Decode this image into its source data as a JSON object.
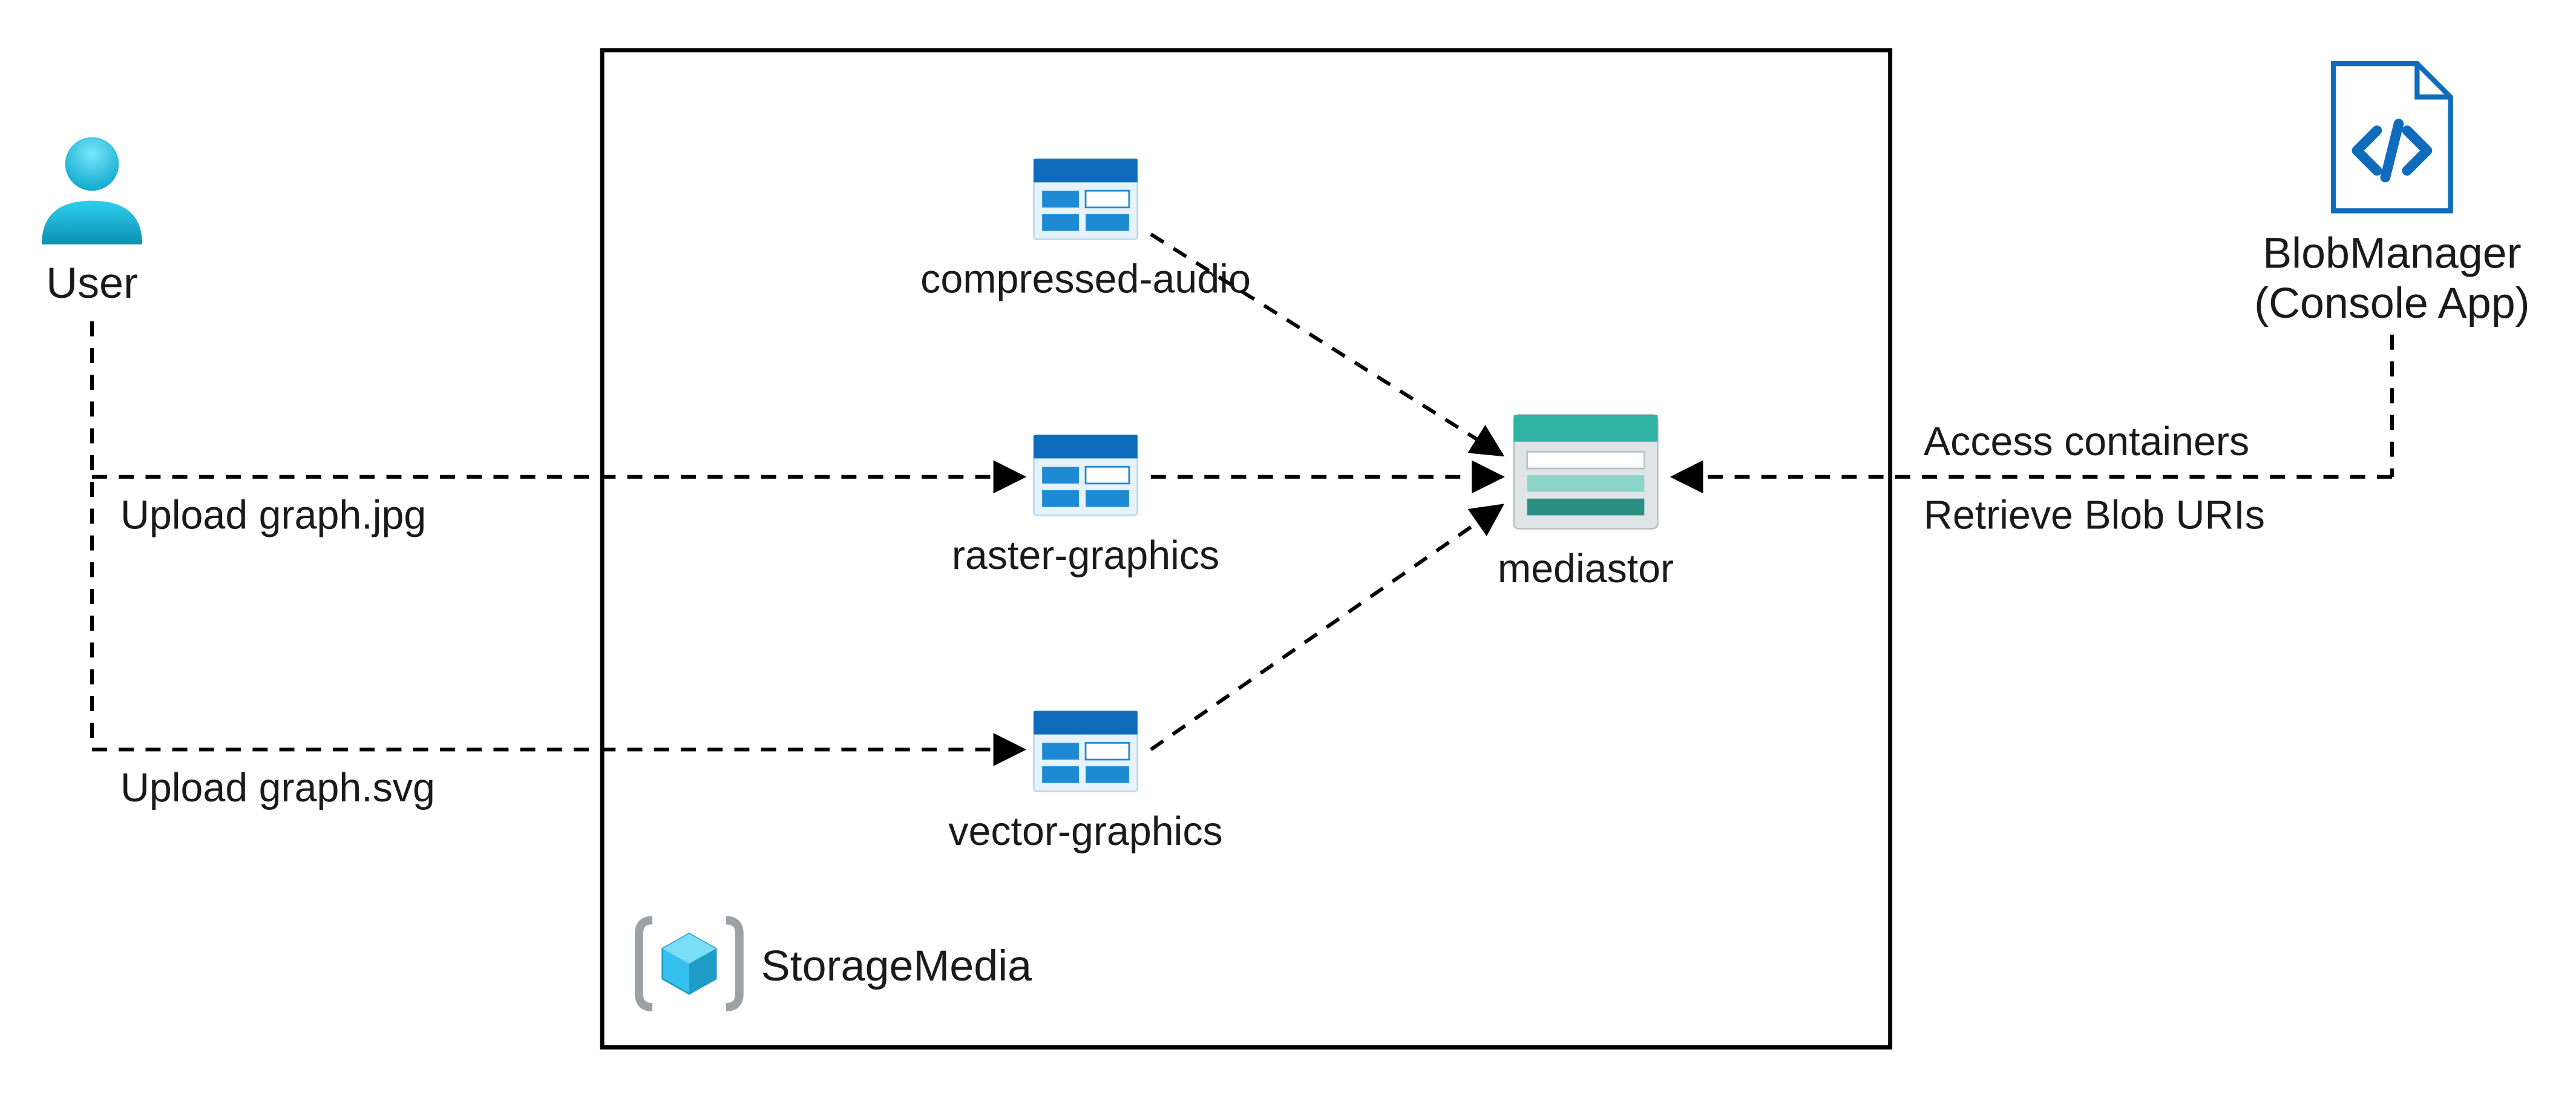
{
  "user": {
    "label": "User"
  },
  "resourceGroup": {
    "name": "StorageMedia"
  },
  "containers": {
    "compressed_audio": "compressed-audio",
    "raster_graphics": "raster-graphics",
    "vector_graphics": "vector-graphics"
  },
  "storageAccount": {
    "name": "mediastor"
  },
  "app": {
    "name": "BlobManager",
    "subtitle": "(Console App)"
  },
  "edges": {
    "upload_jpg": "Upload graph.jpg",
    "upload_svg": "Upload graph.svg",
    "access_containers": "Access containers",
    "retrieve_blob_uris": "Retrieve Blob URIs"
  }
}
